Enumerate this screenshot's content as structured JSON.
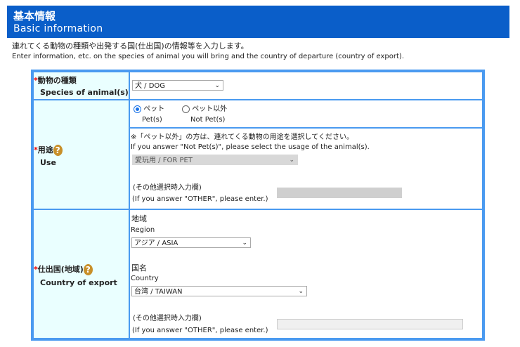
{
  "header": {
    "title_ja": "基本情報",
    "title_en": "Basic information"
  },
  "intro": {
    "ja": "連れてくる動物の種類や出発する国(仕出国)の情報等を入力します。",
    "en": "Enter information, etc. on the species of animal you will bring and the country of departure (country of export)."
  },
  "required_mark": "*",
  "species": {
    "label_ja": "動物の種類",
    "label_en": "Species of animal(s)",
    "value": "犬 / DOG"
  },
  "use": {
    "label_ja": "用途",
    "label_en": "Use",
    "help": "?",
    "options": [
      {
        "ja": "ペット",
        "en": "Pet(s)",
        "selected": true
      },
      {
        "ja": "ペット以外",
        "en": "Not Pet(s)",
        "selected": false
      }
    ],
    "note_ja": "※「ペット以外」の方は、連れてくる動物の用途を選択してください。",
    "note_en": "If you answer \"Not Pet(s)\", please select the usage of the animal(s).",
    "usage_value": "愛玩用 / FOR PET",
    "other_ja": "(その他選択時入力欄)",
    "other_en": "(If you answer \"OTHER\", please enter.)",
    "other_value": ""
  },
  "country": {
    "label_ja": "仕出国(地域)",
    "label_en": "Country of export",
    "help": "?",
    "region_ja": "地域",
    "region_en": "Region",
    "region_value": "アジア / ASIA",
    "country_ja": "国名",
    "country_en": "Country",
    "country_value": "台湾 / TAIWAN",
    "other_ja": "(その他選択時入力欄)",
    "other_en": "(If you answer \"OTHER\", please enter.)",
    "other_value": ""
  }
}
